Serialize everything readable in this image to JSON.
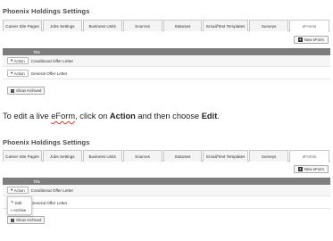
{
  "settings_title": "Phoenix Holdings Settings",
  "tabs": [
    "Career Site Pages",
    "Jobs Settings",
    "Business Units",
    "Sources",
    "Statuses",
    "Email/Text Templates",
    "Surveys",
    "eForms"
  ],
  "active_tab": "eForms",
  "new_eform_label": "New eForm",
  "table": {
    "column_title": "Title",
    "rows": [
      {
        "action_label": "Action",
        "title": "Conditional Offer Letter"
      },
      {
        "action_label": "Action",
        "title": "General Offer Letter"
      }
    ]
  },
  "show_archived_label": "Show Archived",
  "instruction": {
    "prefix": "To edit a live ",
    "eform_word": "eForm",
    "middle": ", click on ",
    "action_word": "Action",
    "and_then": " and then choose ",
    "edit_word": "Edit",
    "end": "."
  },
  "dropdown": {
    "items": [
      "Edit",
      "Archive"
    ]
  },
  "colors": {
    "table_header_bg": "#7d7d7d",
    "spellcheck_underline": "#d93025"
  }
}
